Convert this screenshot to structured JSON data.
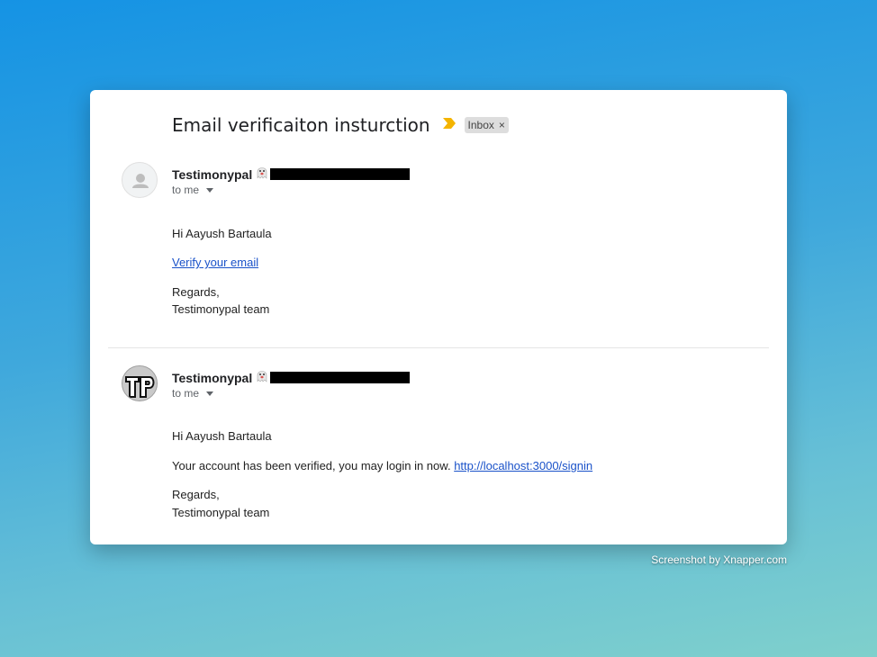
{
  "email": {
    "subject": "Email verificaiton insturction",
    "label": "Inbox",
    "label_close": "×",
    "importance_color": "#f4b400"
  },
  "messages": [
    {
      "sender": "Testimonypal",
      "recipient": "to me",
      "greeting": "Hi Aayush Bartaula",
      "link_text": "Verify your email",
      "regards": "Regards,",
      "signature": "Testimonypal team",
      "avatar": "default-person-icon"
    },
    {
      "sender": "Testimonypal",
      "recipient": "to me",
      "greeting": "Hi Aayush Bartaula",
      "body_text": "Your account has been verified, you may login in now.",
      "link_text": "http://localhost:3000/signin",
      "regards": "Regards,",
      "signature": "Testimonypal team",
      "avatar": "tp-logo"
    }
  ],
  "watermark": "Screenshot by Xnapper.com",
  "colors": {
    "link": "#1a52c9",
    "background_top": "#1593e4",
    "background_bottom": "#7fd0cc"
  }
}
